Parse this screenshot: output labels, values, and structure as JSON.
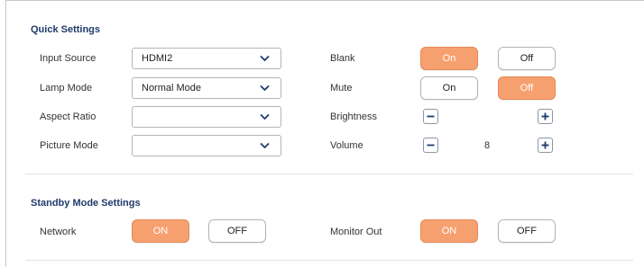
{
  "quick_settings": {
    "title": "Quick Settings",
    "input_source": {
      "label": "Input Source",
      "value": "HDMI2"
    },
    "lamp_mode": {
      "label": "Lamp Mode",
      "value": "Normal Mode"
    },
    "aspect_ratio": {
      "label": "Aspect Ratio",
      "value": ""
    },
    "picture_mode": {
      "label": "Picture Mode",
      "value": ""
    },
    "blank": {
      "label": "Blank",
      "on": "On",
      "off": "Off",
      "selected": "on"
    },
    "mute": {
      "label": "Mute",
      "on": "On",
      "off": "Off",
      "selected": "off"
    },
    "brightness": {
      "label": "Brightness",
      "value": ""
    },
    "volume": {
      "label": "Volume",
      "value": "8"
    }
  },
  "standby_settings": {
    "title": "Standby Mode Settings",
    "network": {
      "label": "Network",
      "on": "ON",
      "off": "OFF",
      "selected": "on"
    },
    "monitor_out": {
      "label": "Monitor Out",
      "on": "ON",
      "off": "OFF",
      "selected": "on"
    }
  },
  "colors": {
    "accent": "#f7a06f",
    "section_title": "#1f3a6b",
    "border": "#b4b4b4"
  },
  "icons": [
    "chevron-down-icon",
    "minus-icon",
    "plus-icon"
  ]
}
